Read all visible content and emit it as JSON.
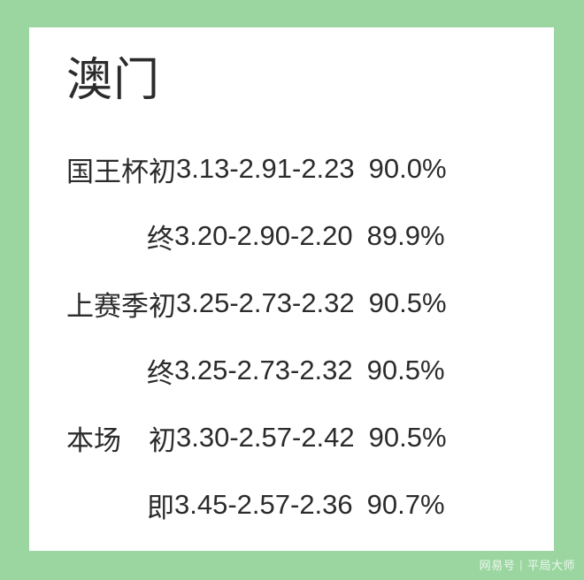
{
  "background_color": "#9bd6a1",
  "card_color": "#ffffff",
  "text_color": "#2b2b2b",
  "title": "澳门",
  "rows": [
    {
      "indent": 0,
      "label": "国王杯初",
      "odds": "3.13-2.91-2.23",
      "pct": "90.0%"
    },
    {
      "indent": 1,
      "label": "终",
      "odds": "3.20-2.90-2.20",
      "pct": "89.9%"
    },
    {
      "indent": 0,
      "label": "上赛季初",
      "odds": "3.25-2.73-2.32",
      "pct": "90.5%"
    },
    {
      "indent": 1,
      "label": "终",
      "odds": "3.25-2.73-2.32",
      "pct": "90.5%"
    },
    {
      "indent": 0,
      "label": "本场　初",
      "odds": "3.30-2.57-2.42",
      "pct": "90.5%"
    },
    {
      "indent": 1,
      "label": "即",
      "odds": "3.45-2.57-2.36",
      "pct": "90.7%"
    }
  ],
  "watermark": {
    "brand": "网易号",
    "separator": "|",
    "account": "平局大师"
  }
}
